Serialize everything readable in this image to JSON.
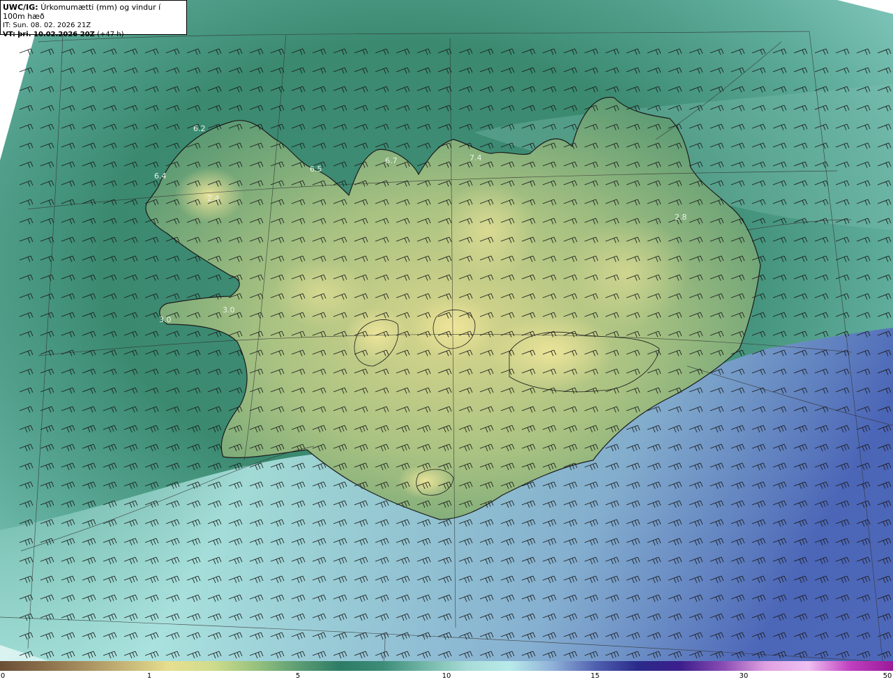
{
  "header": {
    "model": "UWC/IG:",
    "title": "Úrkomumætti (mm) og vindur í 100m hæð",
    "it_line": "IT: Sun. 08. 02. 2026 21Z",
    "vt_prefix": "VT:",
    "vt_bold": "þri. 10.02.2026 20Z",
    "vt_rest": " (+47 h)"
  },
  "map_labels": [
    {
      "name": "label-6-2",
      "text": "6.2"
    },
    {
      "name": "label-6-4",
      "text": "6.4"
    },
    {
      "name": "label-2-4",
      "text": "2.4"
    },
    {
      "name": "label-6-5",
      "text": "6.5"
    },
    {
      "name": "label-6-7",
      "text": "6.7"
    },
    {
      "name": "label-7-4",
      "text": "7.4"
    },
    {
      "name": "label-2-8",
      "text": "2.8"
    },
    {
      "name": "label-3-0-a",
      "text": "3.0"
    },
    {
      "name": "label-3-0-b",
      "text": "3.0"
    }
  ],
  "colorbar": {
    "ticks": [
      "0",
      "1",
      "5",
      "10",
      "15",
      "30",
      "50"
    ],
    "colors": [
      "#6b4f35",
      "#8a6e4a",
      "#a89060",
      "#c8b878",
      "#e7df90",
      "#cfdc8c",
      "#98c27e",
      "#5d9e74",
      "#2d7c66",
      "#3d8c78",
      "#73b7a8",
      "#a8dcd8",
      "#b9eaea",
      "#8fb0d8",
      "#5060b0",
      "#2a2a8a",
      "#3c1e8c",
      "#8a4cb4",
      "#e0a0e0",
      "#f0c0f0",
      "#c040c0",
      "#9a1a9a"
    ]
  }
}
